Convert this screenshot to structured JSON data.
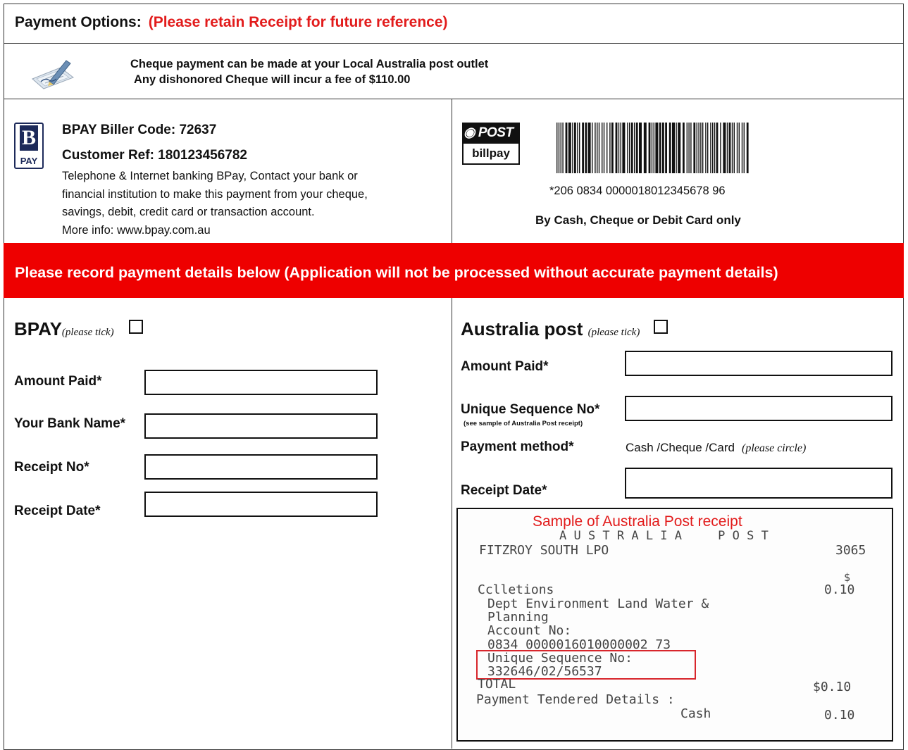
{
  "header": {
    "title": "Payment Options:",
    "note": "(Please retain Receipt for future reference)"
  },
  "cheque": {
    "line1": "Cheque payment can be made at your Local Australia post outlet",
    "line2": "Any dishonored Cheque will incur a fee of $110.00",
    "icon": "cheque-pen-icon"
  },
  "bpay": {
    "logo_letter": "B",
    "logo_text": "PAY",
    "biller_code": "BPAY Biller Code: 72637",
    "customer_ref": "Customer Ref: 180123456782",
    "desc_lines": [
      "Telephone & Internet banking BPay, Contact your bank or",
      "financial institution to make this payment from your cheque,",
      "savings, debit, credit card or transaction account.",
      "More info: www.bpay.com.au"
    ]
  },
  "post_billpay": {
    "logo_top": "POST",
    "logo_bottom": "billpay",
    "barcode_number": "*206 0834 0000018012345678 96",
    "note": "By Cash, Cheque or Debit Card only"
  },
  "banner": {
    "text": "Please record payment details below  (Application will not be processed without accurate payment details)",
    "color": "#ee0000"
  },
  "bpay_form": {
    "title": "BPAY",
    "tick_hint": "(please tick)",
    "fields": {
      "amount_paid": "Amount Paid*",
      "bank_name": "Your Bank Name*",
      "receipt_no": "Receipt No*",
      "receipt_date": "Receipt Date*"
    }
  },
  "post_form": {
    "title": "Australia post",
    "tick_hint": "(please tick)",
    "amount_paid": "Amount Paid*",
    "unique_seq": "Unique Sequence No*",
    "unique_seq_hint": "(see sample of Australia Post receipt)",
    "payment_method": "Payment method*",
    "payment_method_value": "Cash /Cheque /Card",
    "payment_method_hint": "(please circle)",
    "receipt_date": "Receipt Date*"
  },
  "receipt_sample": {
    "title": "Sample of Australia Post receipt",
    "brand": "A U S T R A L I A     P O S T",
    "office": "FITZROY SOUTH LPO",
    "postcode": "3065",
    "currency": "$",
    "collections": "Cclletions",
    "collections_amount": "0.10",
    "dept_line1": "Dept Environment Land Water &",
    "dept_line2": "Planning",
    "account_label": "Account No:",
    "account_no": "0834 0000016010000002 73",
    "useq_label": "Unique Sequence No:",
    "useq_value": "332646/02/56537",
    "total_label": "TOTAL",
    "total_value": "$0.10",
    "tendered": "Payment Tendered Details :",
    "cash_label": "Cash",
    "cash_value": "0.10",
    "highlight_color": "#d8262c"
  }
}
